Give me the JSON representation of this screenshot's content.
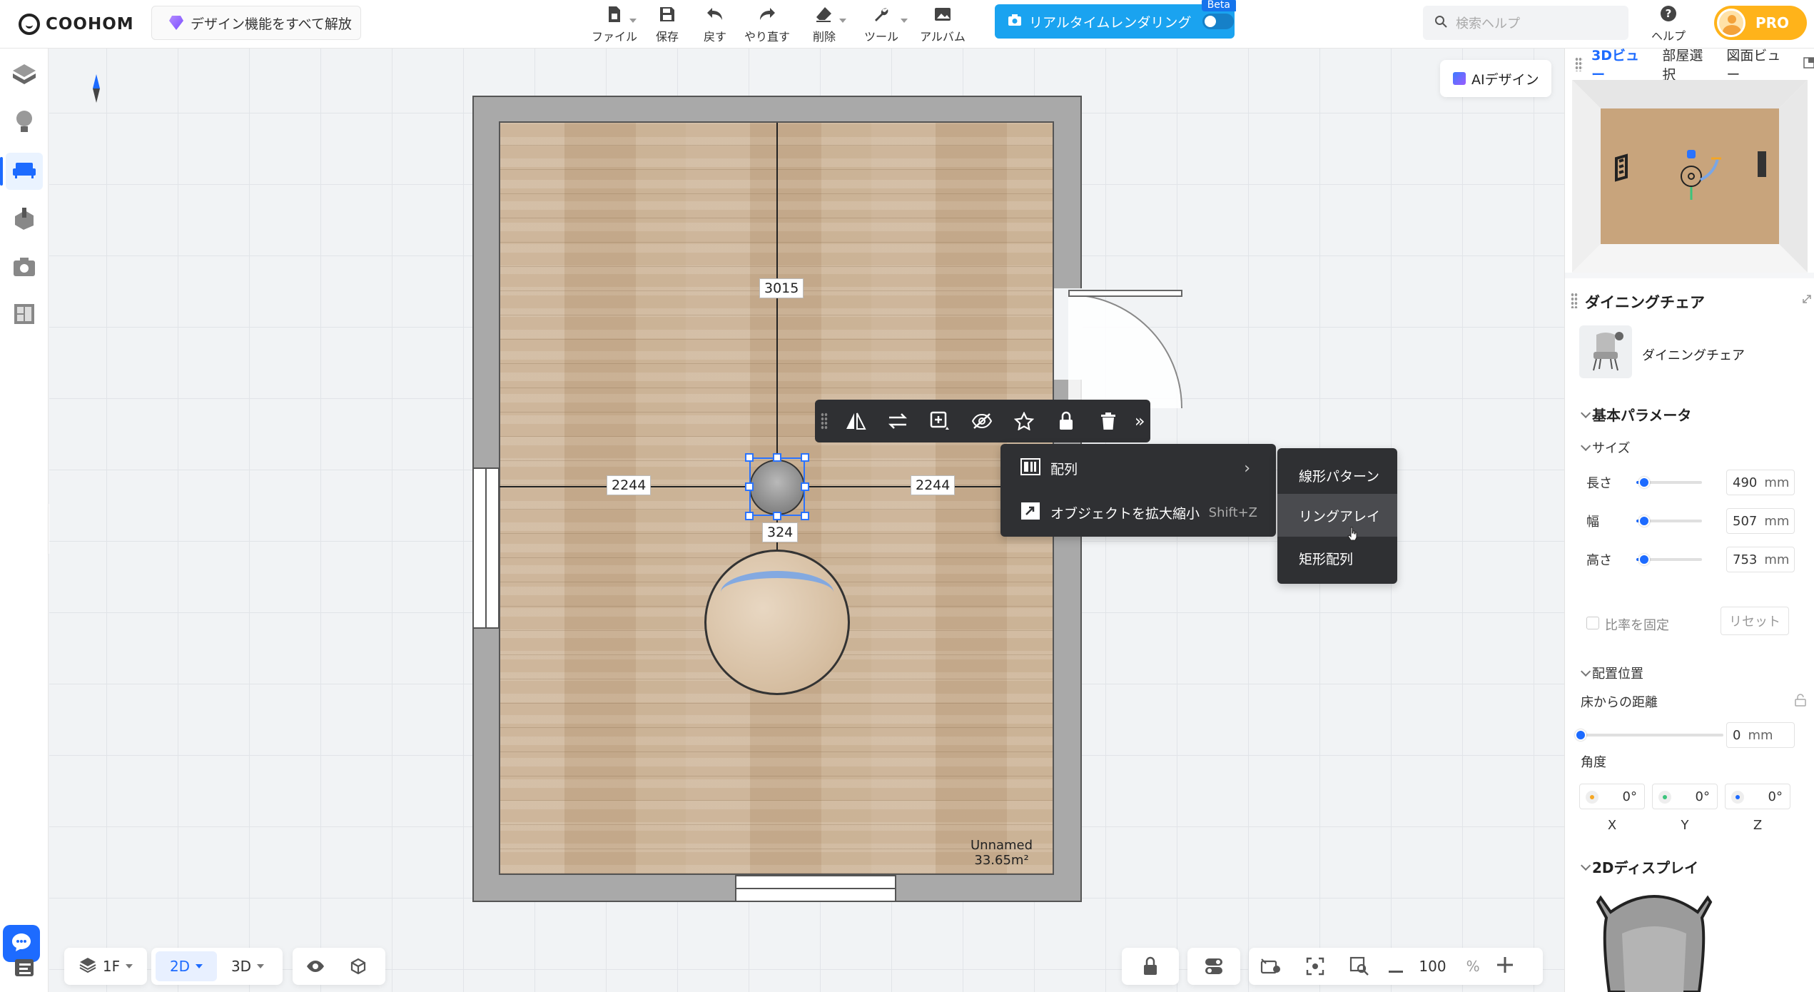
{
  "app": {
    "logo_text": "COOHOM",
    "unlock_label": "デザイン機能をすべて解放"
  },
  "toolbar": {
    "file": "ファイル",
    "save": "保存",
    "undo": "戻す",
    "redo": "やり直す",
    "delete": "削除",
    "tools": "ツール",
    "album": "アルバム",
    "render_label": "リアルタイムレンダリング",
    "beta": "Beta"
  },
  "search": {
    "placeholder": "検索ヘルプ"
  },
  "help_label": "ヘルプ",
  "pro_label": "PRO",
  "canvas": {
    "ai_label": "AIデザイン",
    "dims": {
      "vertical": "3015",
      "left": "2244",
      "right": "2244",
      "below": "324"
    },
    "room": {
      "name": "Unnamed",
      "area": "33.65m²"
    }
  },
  "float_toolbar": {
    "icons": [
      "mirror-icon",
      "replace-icon",
      "duplicate-icon",
      "hide-icon",
      "favorite-icon",
      "lock-icon",
      "trash-icon"
    ],
    "more": "»"
  },
  "context_menu": {
    "items": [
      {
        "label": "配列",
        "has_submenu": true
      },
      {
        "label": "オブジェクトを拡大縮小",
        "shortcut": "Shift+Z"
      }
    ]
  },
  "submenu": {
    "items": [
      "線形パターン",
      "リングアレイ",
      "矩形配列"
    ],
    "hover_index": 1
  },
  "bottom": {
    "floor": "1F",
    "mode_2d": "2D",
    "mode_3d": "3D",
    "zoom": "100",
    "zoom_unit": "%"
  },
  "right_panel": {
    "tabs": [
      "3Dビュー",
      "部屋選択",
      "図面ビュー"
    ],
    "active_tab": 0,
    "title": "ダイニングチェア",
    "object_name": "ダイニングチェア",
    "basic_params": "基本パラメータ",
    "size_title": "サイズ",
    "size": [
      {
        "label": "長さ",
        "value": "490",
        "unit": "mm",
        "level": 0.12
      },
      {
        "label": "幅",
        "value": "507",
        "unit": "mm",
        "level": 0.12
      },
      {
        "label": "高さ",
        "value": "753",
        "unit": "mm",
        "level": 0.12
      }
    ],
    "lock_ratio": "比率を固定",
    "reset": "リセット",
    "placement_title": "配置位置",
    "floor_distance_label": "床からの距離",
    "floor_distance": {
      "value": "0",
      "unit": "mm",
      "level": 0
    },
    "angle_label": "角度",
    "angles": [
      {
        "axis": "X",
        "value": "0°",
        "color": "#f5a623"
      },
      {
        "axis": "Y",
        "value": "0°",
        "color": "#3cc47c"
      },
      {
        "axis": "Z",
        "value": "0°",
        "color": "#1d6bff"
      }
    ],
    "display_title": "2Dディスプレイ"
  },
  "colors": {
    "accent": "#1d6bff",
    "render": "#1aa3f0",
    "pro": "#ffb31a",
    "menu_bg": "#2f3033"
  }
}
